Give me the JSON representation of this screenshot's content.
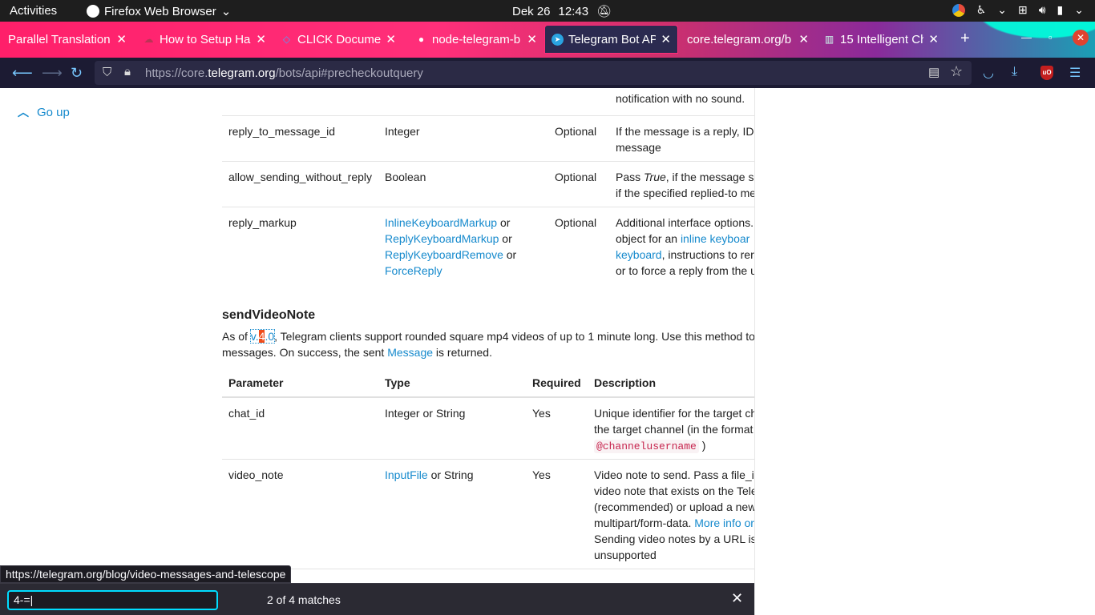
{
  "system_bar": {
    "activities": "Activities",
    "app_name": "Firefox Web Browser",
    "date": "Dek 26",
    "time": "12:43"
  },
  "tabs": [
    {
      "label": "Parallel Translation",
      "icon": "none"
    },
    {
      "label": "How to Setup Ha",
      "icon": "cloud-icon"
    },
    {
      "label": "CLICK Document",
      "icon": "diamond-icon"
    },
    {
      "label": "node-telegram-b",
      "icon": "github-icon"
    },
    {
      "label": "Telegram Bot AP",
      "icon": "telegram-icon"
    },
    {
      "label": "core.telegram.org/b",
      "icon": "none"
    },
    {
      "label": "15 Intelligent Ch",
      "icon": "bars-icon"
    }
  ],
  "urlbar": {
    "prefix": "https://core.",
    "domain": "telegram.org",
    "path": "/bots/api#precheckoutquery"
  },
  "sidebar": {
    "go_up": "Go up"
  },
  "table1": {
    "partial_top": "notification with no sound.",
    "rows": [
      {
        "param": "reply_to_message_id",
        "type_text": "Integer",
        "required": "Optional",
        "desc1": "If the message is a reply, ID",
        "desc2": "message"
      },
      {
        "param": "allow_sending_without_reply",
        "type_text": "Boolean",
        "required": "Optional",
        "desc_pre": "Pass ",
        "desc_em": "True",
        "desc_post": ", if the message s",
        "desc2": "if the specified replied-to me"
      },
      {
        "param": "reply_markup",
        "type_l1": "InlineKeyboardMarkup",
        "type_l2": "ReplyKeyboardMarkup",
        "type_l3": "ReplyKeyboardRemove",
        "type_l4": "ForceReply",
        "or": "or",
        "required": "Optional",
        "desc1": "Additional interface options.",
        "desc2_pre": "object for an ",
        "desc2_link": "inline keyboar",
        "desc3_link": "keyboard",
        "desc3_post": ", instructions to rer",
        "desc4": "or to force a reply from the u"
      }
    ]
  },
  "section": {
    "title": "sendVideoNote",
    "p1_pre": "As of ",
    "p1_v": "v.",
    "p1_hl": "4",
    "p1_vpost": ".0",
    "p1_post": ", Telegram clients support rounded square mp4 videos of up to 1 minute long. Use this method to",
    "p2_pre": "messages. On success, the sent ",
    "p2_link": "Message",
    "p2_post": " is returned."
  },
  "table2": {
    "headers": [
      "Parameter",
      "Type",
      "Required",
      "Description"
    ],
    "rows": [
      {
        "param": "chat_id",
        "type_text": "Integer or String",
        "required": "Yes",
        "desc1": "Unique identifier for the target ch",
        "desc2": "the target channel (in the format",
        "code": "@channelusername",
        "desc3_post": ")"
      },
      {
        "param": "video_note",
        "type_link": "InputFile",
        "type_post": " or String",
        "required": "Yes",
        "desc1": "Video note to send. Pass a file_i",
        "desc2": "video note that exists on the Tele",
        "desc3": "(recommended) or upload a new",
        "desc4_pre": "multipart/form-data. ",
        "desc4_link": "More info or",
        "desc5": "Sending video notes by a URL is",
        "desc6": "unsupported"
      }
    ]
  },
  "status_link": "https://telegram.org/blog/video-messages-and-telescope",
  "findbar": {
    "query": "4-=",
    "matches": "2 of 4 matches"
  }
}
